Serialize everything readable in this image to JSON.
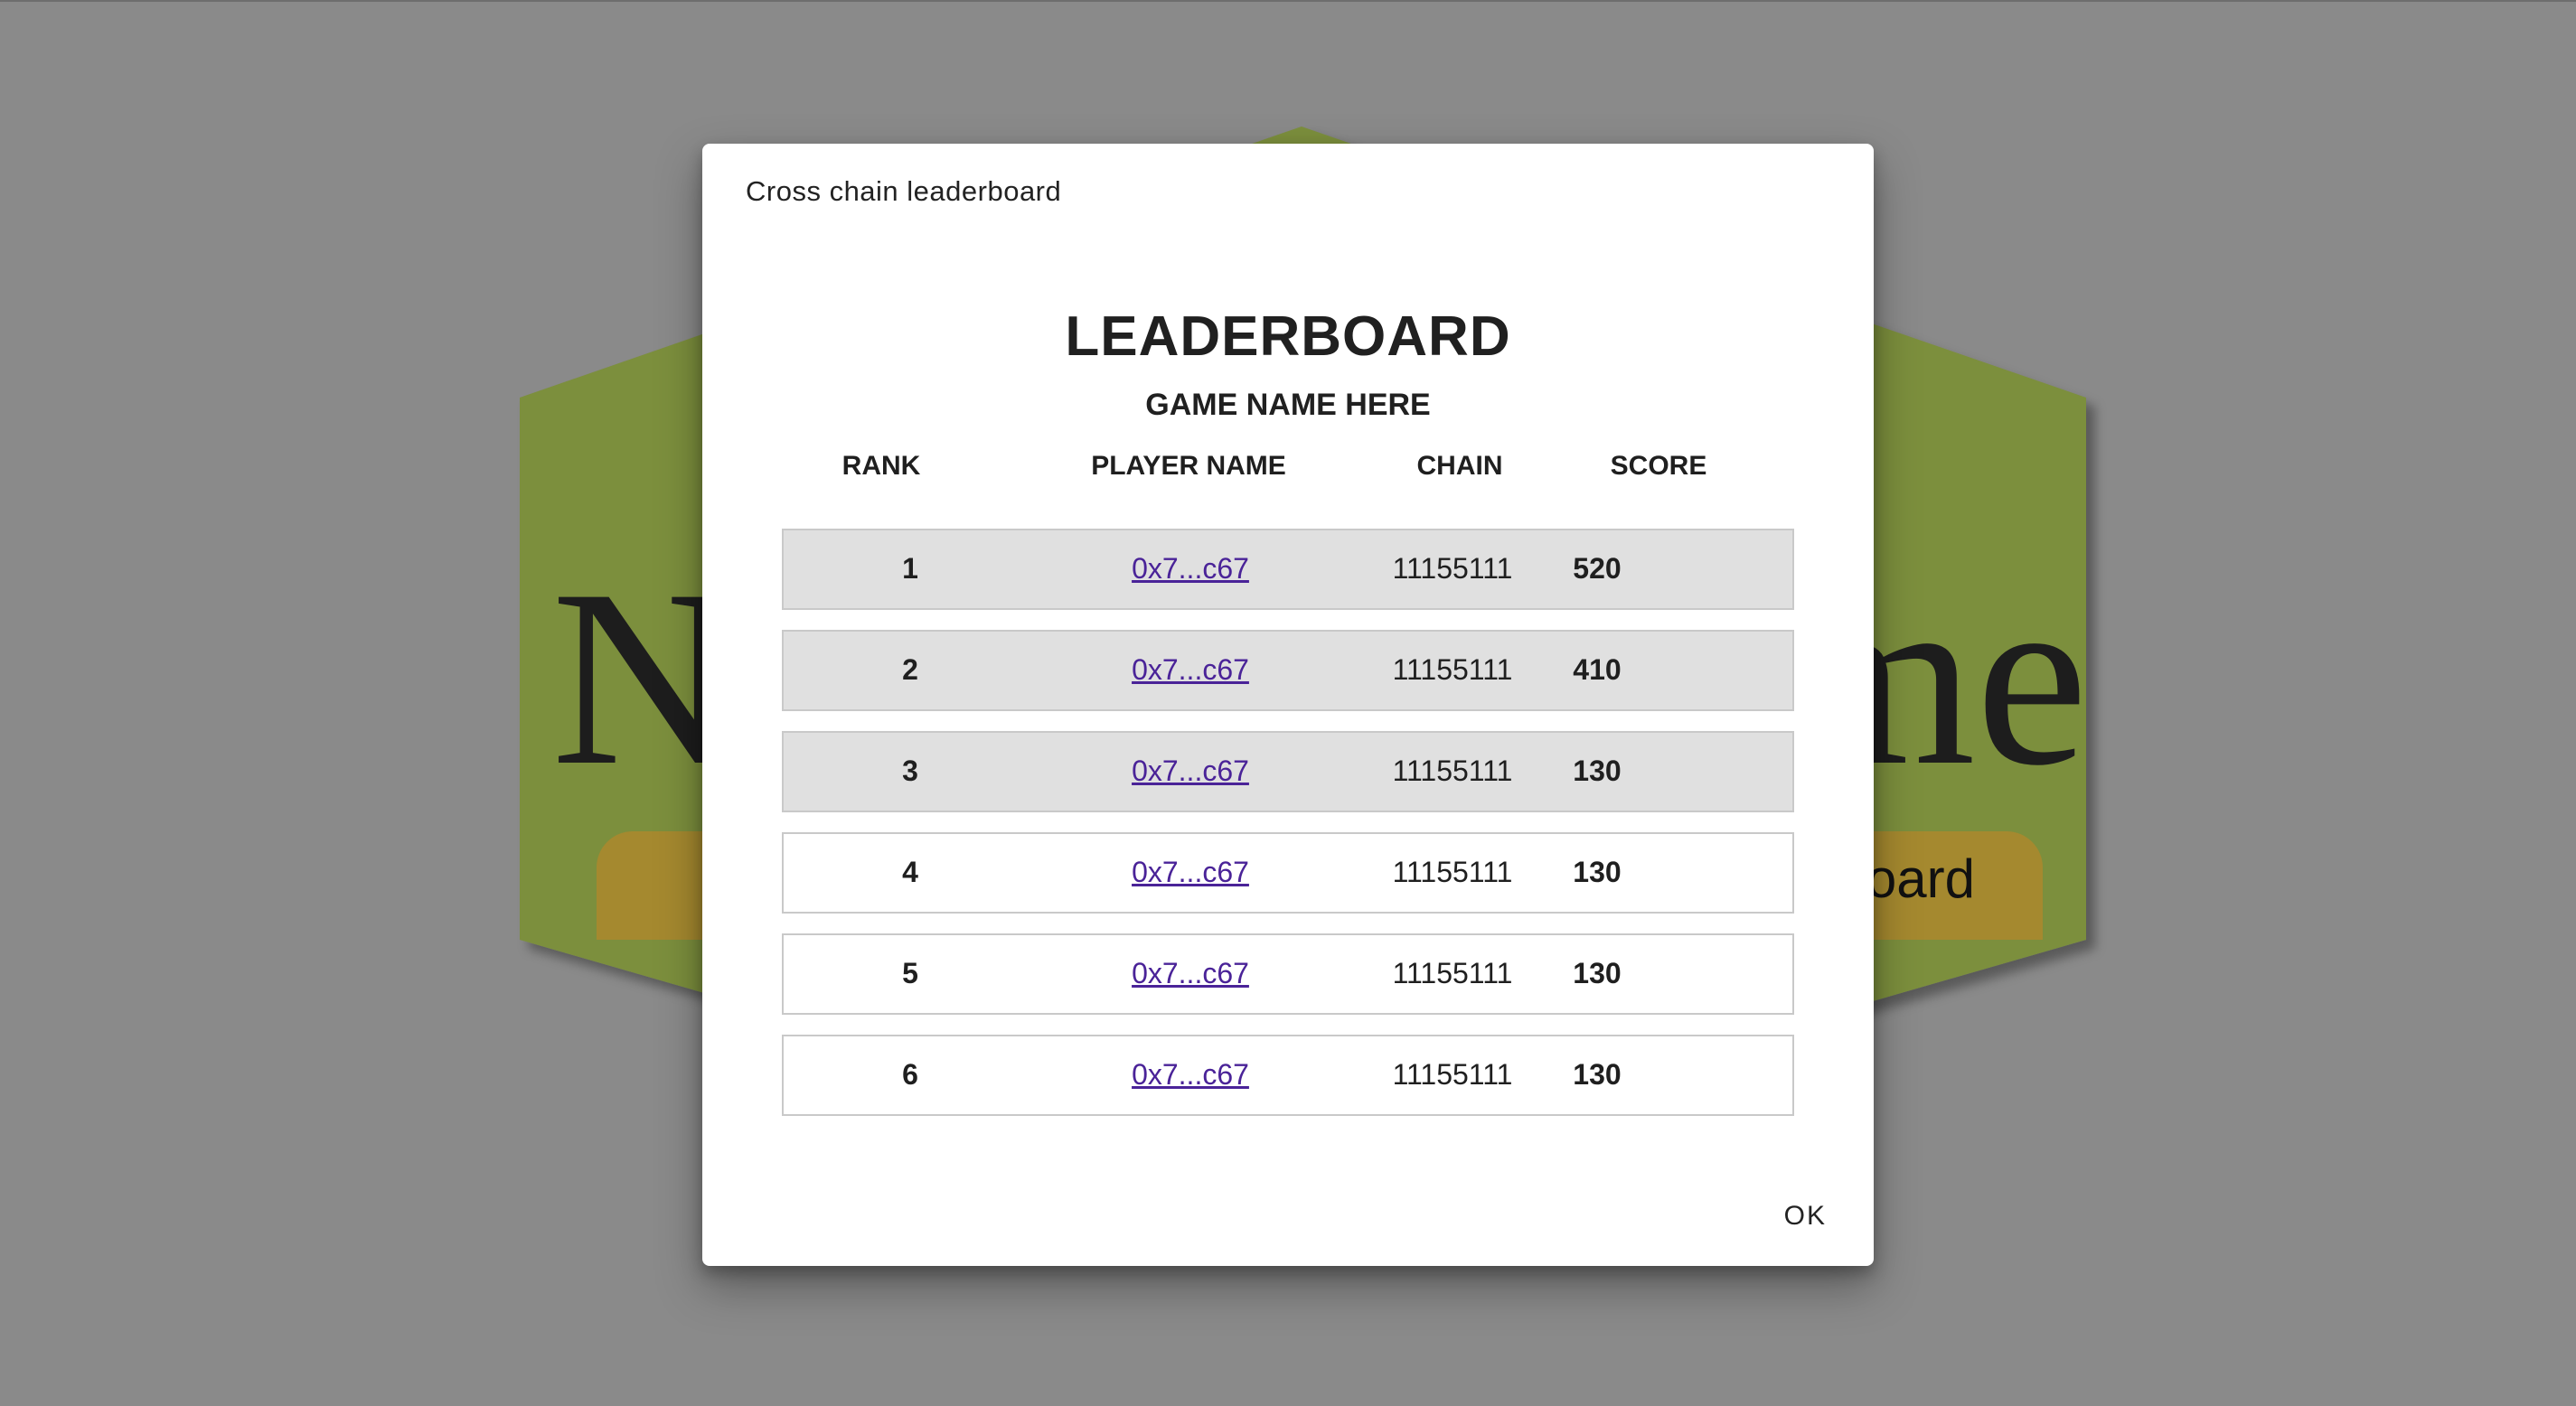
{
  "background": {
    "title_left": "N",
    "title_right": "me",
    "button_label": "oard",
    "card_color": "#7b8f3c",
    "button_color": "#a5892f",
    "overlay_color": "#8a8a8a"
  },
  "dialog": {
    "title": "Cross chain leaderboard",
    "heading": "LEADERBOARD",
    "subheading": "GAME NAME HERE",
    "columns": {
      "rank": "RANK",
      "player": "PLAYER NAME",
      "chain": "CHAIN",
      "score": "SCORE"
    },
    "rows": [
      {
        "rank": "1",
        "player": "0x7...c67",
        "chain": "11155111",
        "score": "520"
      },
      {
        "rank": "2",
        "player": "0x7...c67",
        "chain": "11155111",
        "score": "410"
      },
      {
        "rank": "3",
        "player": "0x7...c67",
        "chain": "11155111",
        "score": "130"
      },
      {
        "rank": "4",
        "player": "0x7...c67",
        "chain": "11155111",
        "score": "130"
      },
      {
        "rank": "5",
        "player": "0x7...c67",
        "chain": "11155111",
        "score": "130"
      },
      {
        "rank": "6",
        "player": "0x7...c67",
        "chain": "11155111",
        "score": "130"
      }
    ],
    "ok_label": "OK",
    "highlight_color": "#e0e0e0",
    "link_color": "#4a2398"
  }
}
